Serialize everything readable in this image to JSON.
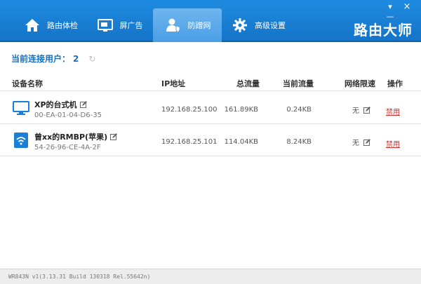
{
  "tabs": [
    {
      "label": "路由体检",
      "icon": "house-icon"
    },
    {
      "label": "屏广告",
      "icon": "monitor-icon"
    },
    {
      "label": "防蹭网",
      "icon": "user-shield-icon"
    },
    {
      "label": "高级设置",
      "icon": "gear-icon"
    }
  ],
  "active_tab": 2,
  "brand": "路由大师",
  "window_controls": {
    "minimize": "▾ —",
    "close": "×"
  },
  "summary": {
    "label": "当前连接用户：",
    "count": "2"
  },
  "table": {
    "headers": {
      "name": "设备名称",
      "ip": "IP地址",
      "total": "总流量",
      "current": "当前流量",
      "limit": "网络限速",
      "action": "操作"
    },
    "rows": [
      {
        "name": "XP的台式机",
        "mac": "00-EA-01-04-D6-35",
        "ip": "192.168.25.100",
        "total": "161.89KB",
        "current": "0.24KB",
        "limit": "无",
        "action": "禁用",
        "device_icon": "desktop-icon"
      },
      {
        "name": "曾xx的RMBP(苹果)",
        "mac": "54-26-96-CE-4A-2F",
        "ip": "192.168.25.101",
        "total": "114.04KB",
        "current": "8.24KB",
        "limit": "无",
        "action": "禁用",
        "device_icon": "wifi-device-icon"
      }
    ]
  },
  "footer": "WR843N v1(3.13.31 Build 130318 Rel.55642n)",
  "colors": {
    "header_blue": "#1a7fd6",
    "accent": "#1a6fbf",
    "danger": "#d32f2f"
  }
}
